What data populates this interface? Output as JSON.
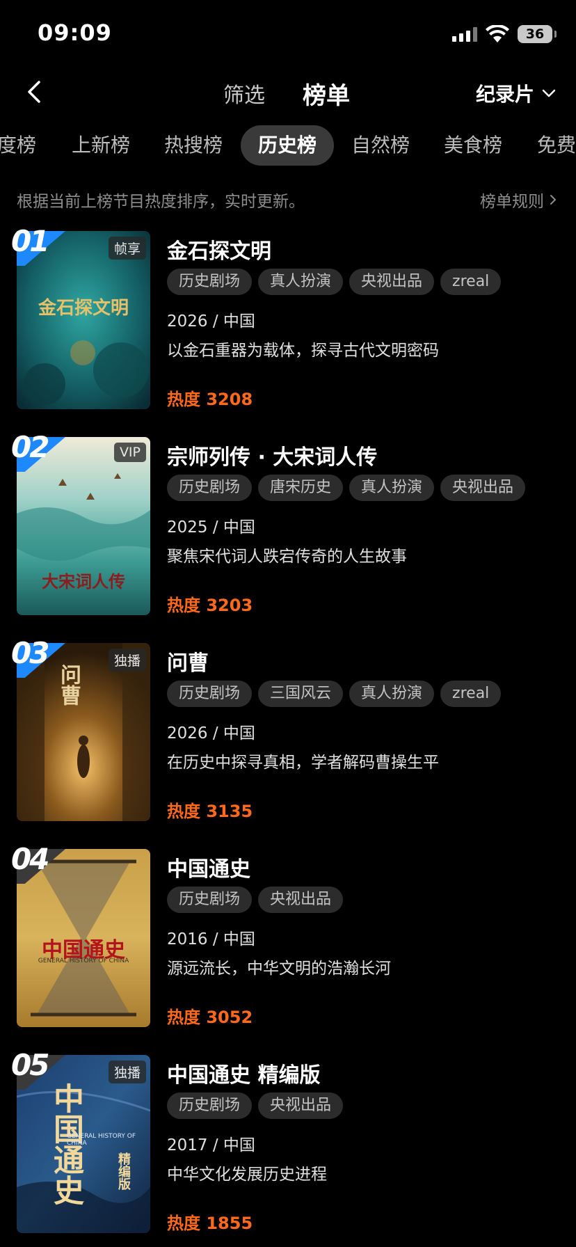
{
  "status_bar": {
    "time": "09:09",
    "battery": "36"
  },
  "nav": {
    "filter_label": "筛选",
    "chart_label": "榜单",
    "genre": "纪录片"
  },
  "tabs": [
    {
      "label": "度榜"
    },
    {
      "label": "上新榜"
    },
    {
      "label": "热搜榜"
    },
    {
      "label": "历史榜",
      "active": true
    },
    {
      "label": "自然榜"
    },
    {
      "label": "美食榜"
    },
    {
      "label": "免费"
    }
  ],
  "info": {
    "text": "根据当前上榜节目热度排序，实时更新。",
    "rules_label": "榜单规则"
  },
  "items": [
    {
      "rank": "01",
      "badge": "帧享",
      "poster_text": "金石探文明",
      "title": "金石探文明",
      "tags": [
        "历史剧场",
        "真人扮演",
        "央视出品",
        "zreal"
      ],
      "meta": "2026 / 中国",
      "desc": "以金石重器为载体，探寻古代文明密码",
      "heat": "热度 3208"
    },
    {
      "rank": "02",
      "badge": "VIP",
      "poster_text": "大宋词人传",
      "title": "宗师列传 · 大宋词人传",
      "tags": [
        "历史剧场",
        "唐宋历史",
        "真人扮演",
        "央视出品"
      ],
      "meta": "2025 / 中国",
      "desc": "聚焦宋代词人跌宕传奇的人生故事",
      "heat": "热度 3203"
    },
    {
      "rank": "03",
      "badge": "独播",
      "poster_text": "问曹",
      "title": "问曹",
      "tags": [
        "历史剧场",
        "三国风云",
        "真人扮演",
        "zreal"
      ],
      "meta": "2026 / 中国",
      "desc": "在历史中探寻真相，学者解码曹操生平",
      "heat": "热度 3135"
    },
    {
      "rank": "04",
      "badge": "",
      "poster_text": "中国通史",
      "poster_subtext": "GENERAL HISTORY OF CHINA",
      "title": "中国通史",
      "tags": [
        "历史剧场",
        "央视出品"
      ],
      "meta": "2016 / 中国",
      "desc": "源远流长，中华文明的浩瀚长河",
      "heat": "热度 3052"
    },
    {
      "rank": "05",
      "badge": "独播",
      "poster_text": "中国通史",
      "poster_subtext": "GENERAL HISTORY OF CHINA",
      "poster_edition": "精编版",
      "title": "中国通史 精编版",
      "tags": [
        "历史剧场",
        "央视出品"
      ],
      "meta": "2017 / 中国",
      "desc": "中华文化发展历史进程",
      "heat": "热度 1855"
    }
  ],
  "colors": {
    "heat": "#ff6a1a",
    "rank_flag": "#1e88ff",
    "tag_bg": "#2c2c2c",
    "tab_active_bg": "#3a3a3a"
  }
}
